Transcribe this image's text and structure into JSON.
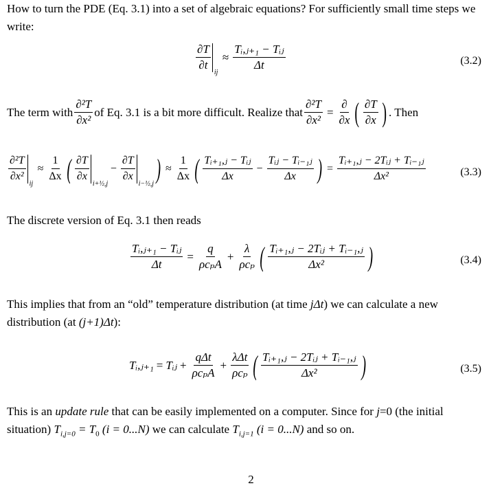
{
  "paragraphs": {
    "p1": "How to turn the PDE (Eq. 3.1) into a set of algebraic equations? For sufficiently small time steps we write:",
    "p2_a": "The term with",
    "p2_b": "of Eq. 3.1 is a bit more difficult. Realize that",
    "p2_c": ". Then",
    "p3": "The discrete version of Eq. 3.1 then reads",
    "p4_a": "This implies that from an “old” temperature distribution (at time",
    "p4_b": "jΔt",
    "p4_c": ") we can calculate a new distribution (at",
    "p4_d": "(j+1)Δt",
    "p4_e": "):",
    "p5_a": "This is an",
    "p5_em": "update rule",
    "p5_b": "that can be easily implemented on a computer. Since for",
    "p5_j": "j",
    "p5_c": "=0 (the initial situation)",
    "p5_m1": "T",
    "p5_m1sub": "i,j=0",
    "p5_m2": "= T",
    "p5_m2sub": "0",
    "p5_m3": "(i = 0...N)",
    "p5_d": "we can calculate",
    "p5_m4": "T",
    "p5_m4sub": "i,j=1",
    "p5_m5": "(i = 0...N)",
    "p5_e": "and so on."
  },
  "equations": {
    "eq32": {
      "number": "(3.2)",
      "lhs_num": "∂T",
      "lhs_den": "∂t",
      "lhs_sub": "ij",
      "op": "≈",
      "rhs_num": "Tᵢ,ⱼ₊₁ − Tᵢⱼ",
      "rhs_den": "Δt"
    },
    "inline1": {
      "num": "∂²T",
      "den": "∂x²"
    },
    "inline2": {
      "num": "∂²T",
      "den": "∂x²",
      "op": "=",
      "d_num": "∂",
      "d_den": "∂x",
      "in_num": "∂T",
      "in_den": "∂x"
    },
    "eq33": {
      "number": "(3.3)",
      "lhs_num": "∂²T",
      "lhs_den": "∂x²",
      "lhs_sub": "ij",
      "op1": "≈",
      "c1_num": "1",
      "c1_den": "Δx",
      "t1_num": "∂T",
      "t1_den": "∂x",
      "t1_sub": "i+½,j",
      "minus": "−",
      "t2_num": "∂T",
      "t2_den": "∂x",
      "t2_sub": "i−½,j",
      "op2": "≈",
      "c2_num": "1",
      "c2_den": "Δx",
      "f1_num": "Tᵢ₊₁,ⱼ − Tᵢⱼ",
      "f1_den": "Δx",
      "f2_num": "Tᵢⱼ − Tᵢ₋₁ⱼ",
      "f2_den": "Δx",
      "op3": "=",
      "r_num": "Tᵢ₊₁,ⱼ − 2Tᵢⱼ + Tᵢ₋₁ⱼ",
      "r_den": "Δx²"
    },
    "eq34": {
      "number": "(3.4)",
      "lhs_num": "Tᵢ,ⱼ₊₁ − Tᵢⱼ",
      "lhs_den": "Δt",
      "op1": "=",
      "a_num": "q",
      "a_den": "ρcₚA",
      "op2": "+",
      "b_num": "λ",
      "b_den": "ρcₚ",
      "c_num": "Tᵢ₊₁,ⱼ − 2Tᵢⱼ + Tᵢ₋₁,ⱼ",
      "c_den": "Δx²"
    },
    "eq35": {
      "number": "(3.5)",
      "lhs": "Tᵢ,ⱼ₊₁",
      "op1": "=",
      "t": "Tᵢⱼ",
      "op2": "+",
      "a_num": "qΔt",
      "a_den": "ρcₚA",
      "op3": "+",
      "b_num": "λΔt",
      "b_den": "ρcₚ",
      "c_num": "Tᵢ₊₁,ⱼ − 2Tᵢⱼ + Tᵢ₋₁,ⱼ",
      "c_den": "Δx²"
    }
  },
  "page_number": "2"
}
